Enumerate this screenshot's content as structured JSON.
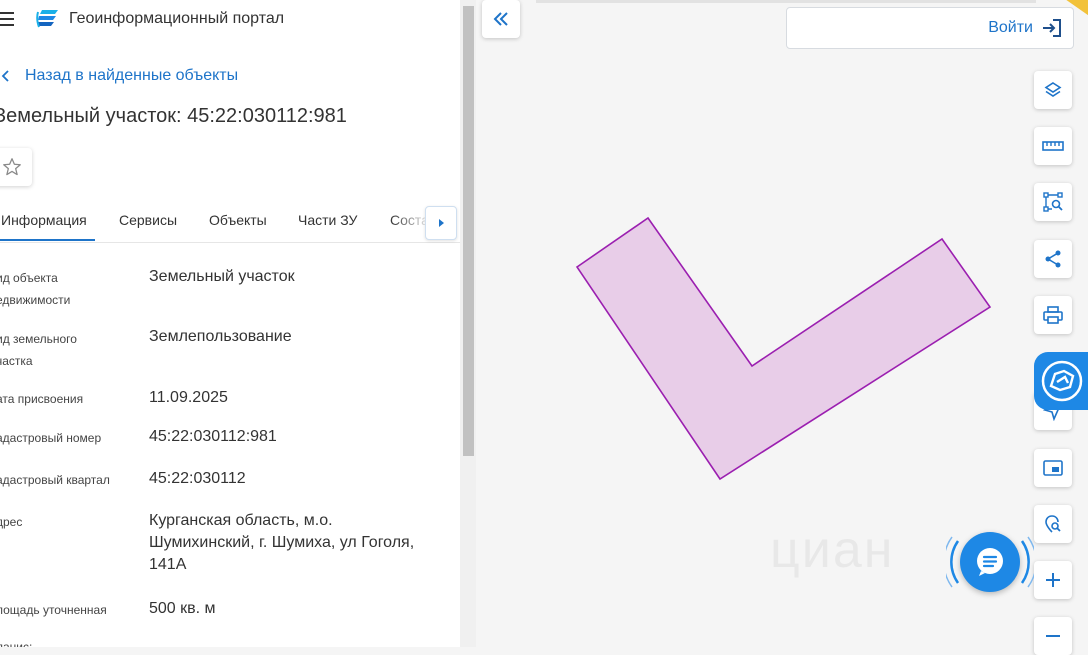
{
  "header": {
    "app_title": "Геоинформационный портал"
  },
  "nav": {
    "back_label": "Назад в найденные объекты"
  },
  "object": {
    "title": "Земельный участок: 45:22:030112:981"
  },
  "tabs": [
    {
      "label": "Информация"
    },
    {
      "label": "Сервисы"
    },
    {
      "label": "Объекты"
    },
    {
      "label": "Части ЗУ"
    },
    {
      "label": "Соста"
    }
  ],
  "fields": [
    {
      "label": "ид объекта\nедвижимости",
      "value": "Земельный участок"
    },
    {
      "label": "ид земельного\nчастка",
      "value": "Землепользование"
    },
    {
      "label": "ата присвоения",
      "value": "11.09.2025"
    },
    {
      "label": "адастровый номер",
      "value": "45:22:030112:981"
    },
    {
      "label": "адастровый квартал",
      "value": "45:22:030112"
    },
    {
      "label": "дрес",
      "value": "Курганская область, м.о.\nШумихинский, г. Шумиха, ул Гоголя,\n141А"
    },
    {
      "label": "лощадь уточненная",
      "value": "500 кв. м"
    },
    {
      "label": "ланис:",
      "value": ""
    }
  ],
  "map": {
    "login_label": "Войти",
    "watermark": "циан",
    "parcel_fill": "#e8cde8",
    "parcel_stroke": "#9b1fb0"
  },
  "colors": {
    "accent": "#1e74c9",
    "widget": "#1e88e5"
  },
  "icons": {
    "menu": "hamburger-icon",
    "logo": "portal-logo",
    "back": "chevron-left-icon",
    "favorite": "star-icon",
    "collapse": "double-chevron-left-icon",
    "login": "login-icon",
    "tools": [
      "layers-icon",
      "ruler-icon",
      "area-select-icon",
      "share-icon",
      "print-icon",
      "locate-icon",
      "minimap-icon",
      "search-location-icon",
      "zoom-in-icon",
      "zoom-out-icon"
    ],
    "widget": "map-widget-icon",
    "chat": "chat-icon"
  }
}
